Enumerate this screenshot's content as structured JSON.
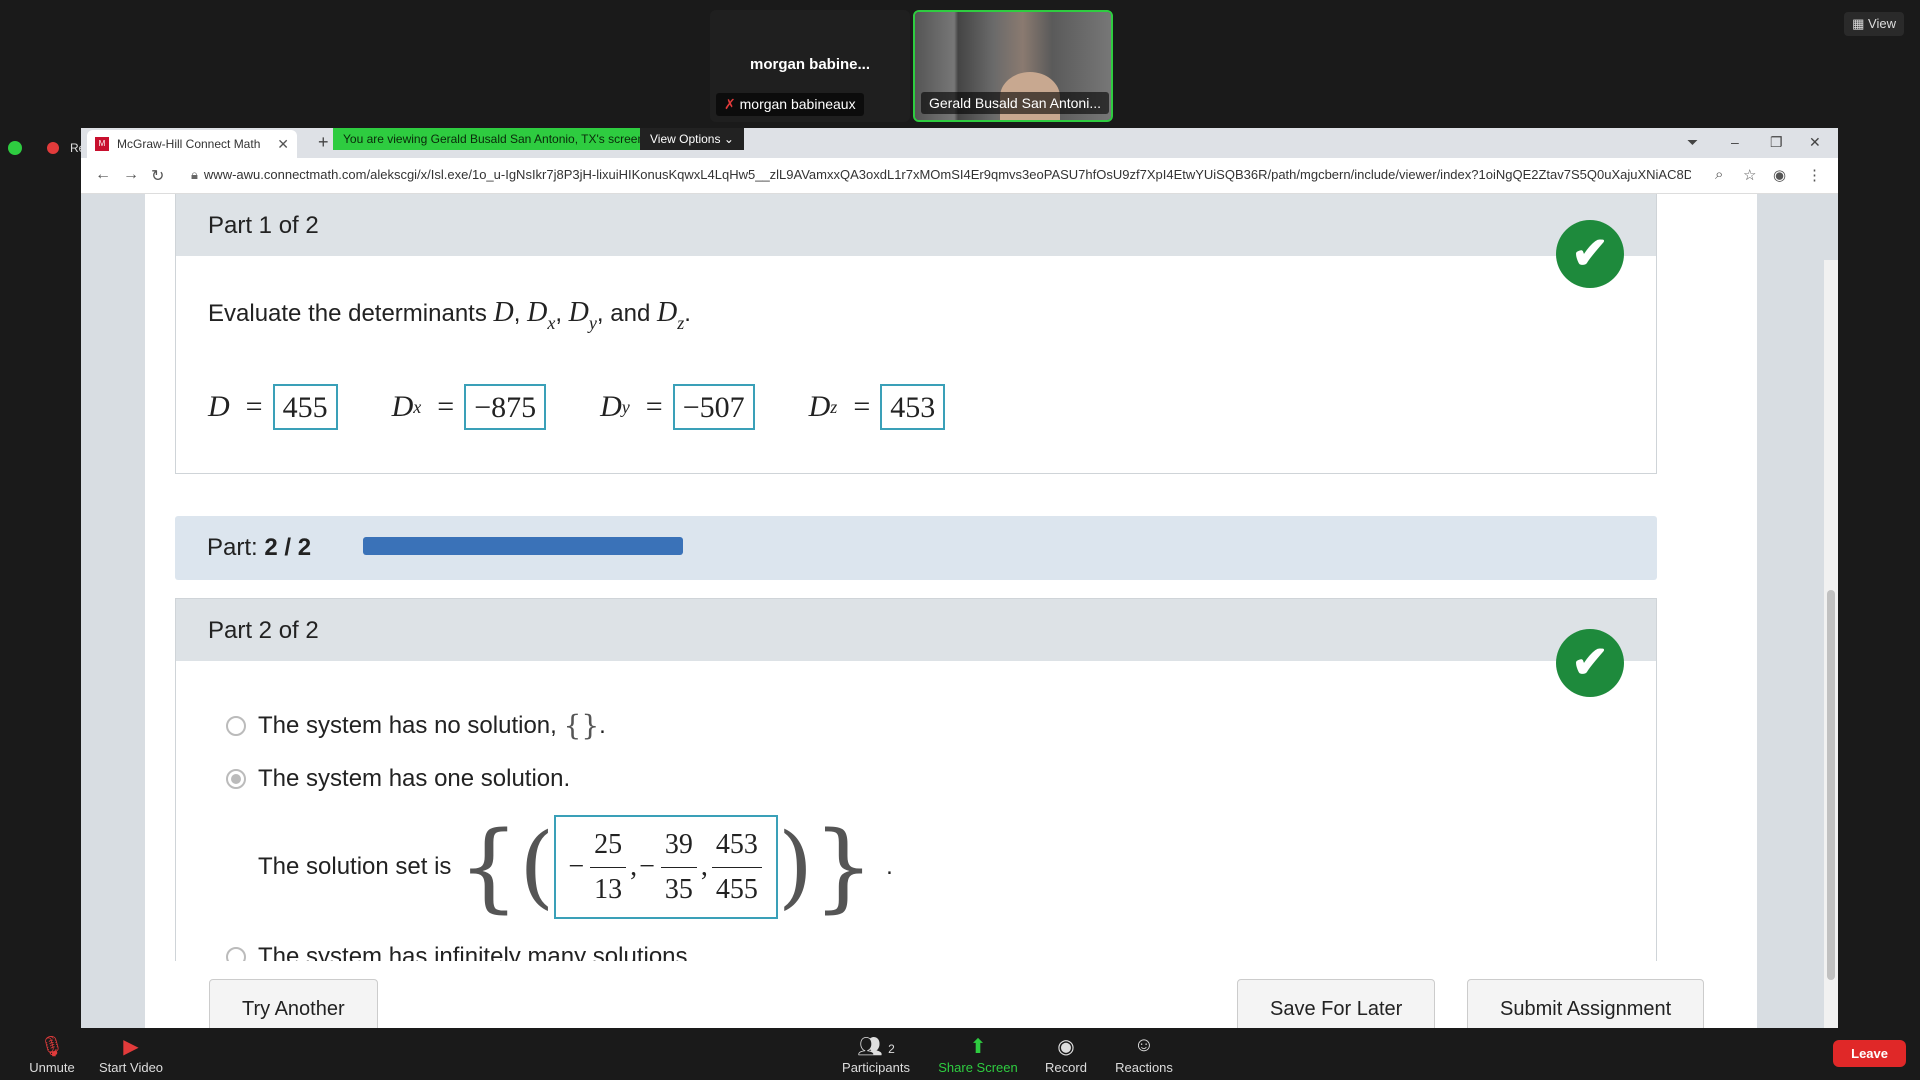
{
  "zoom": {
    "tile1_name": "morgan babine...",
    "tile1_caption": "morgan babineaux",
    "tile2_caption": "Gerald Busald San Antoni...",
    "view_label": "View",
    "left_label": "Re",
    "toolbar": {
      "unmute": "Unmute",
      "start_video": "Start Video",
      "participants": "Participants",
      "participants_count": "2",
      "share_screen": "Share Screen",
      "record": "Record",
      "reactions": "Reactions",
      "leave": "Leave"
    }
  },
  "browser": {
    "tab_title": "McGraw-Hill Connect Math",
    "share_banner": "You are viewing Gerald Busald San Antonio, TX's screen",
    "view_options": "View Options",
    "url": "www-awu.connectmath.com/alekscgi/x/Isl.exe/1o_u-IgNsIkr7j8P3jH-lixuiHIKonusKqwxL4LqHw5__zlL9AVamxxQA3oxdL1r7xMOmSI4Er9qmvs3eoPASU7hfOsU9zf7XpI4EtwYUiSQB36R/path/mgcbern/include/viewer/index?1oiNgQE2Ztav7S5Q0uXajuXNiAC8D7L9F-CPo..."
  },
  "part1": {
    "heading": "Part 1 of 2",
    "question_prefix": "Evaluate the determinants",
    "D_label": "D",
    "Dx_label": "D",
    "Dx_sub": "x",
    "Dy_label": "D",
    "Dy_sub": "y",
    "Dz_label": "D",
    "Dz_sub": "z",
    "and_word": "and",
    "D_value": "455",
    "Dx_value": "−875",
    "Dy_value": "−507",
    "Dz_value": "453"
  },
  "progress": {
    "label": "Part:",
    "value": "2 / 2",
    "fraction": 1.0
  },
  "part2": {
    "heading": "Part 2 of 2",
    "option1": "The system has no solution,",
    "option1_set": "{}",
    "option2": "The system has one solution.",
    "solution_prefix": "The solution set is",
    "x_num": "25",
    "x_den": "13",
    "y_num": "39",
    "y_den": "35",
    "z_num": "453",
    "z_den": "455",
    "option3": "The system has infinitely many solutions."
  },
  "footer": {
    "try_another": "Try Another",
    "save_for_later": "Save For Later",
    "submit": "Submit Assignment"
  },
  "colors": {
    "check_green": "#1e8a3c",
    "progress_blue": "#3a72b8",
    "answer_border": "#3aa0b8",
    "banner_green": "#2ecc40"
  }
}
